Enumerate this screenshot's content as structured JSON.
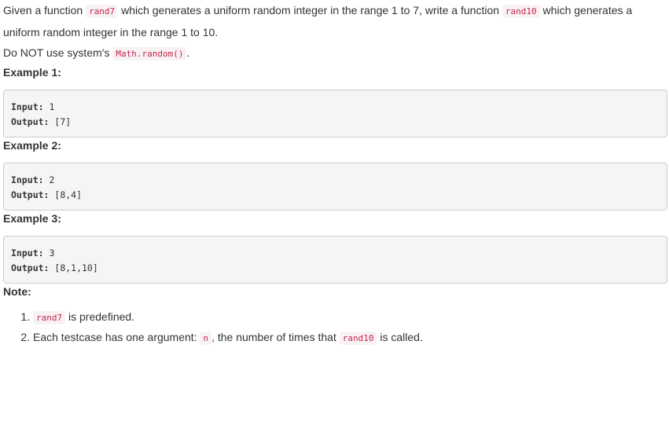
{
  "description": {
    "line1_pre": "Given a function ",
    "line1_code1": "rand7",
    "line1_mid": " which generates a uniform random integer in the range 1 to 7, write a function ",
    "line1_code2": "rand10",
    "line1_post": " which generates a uniform random integer in the range 1 to 10.",
    "line2_pre": "Do NOT use system's ",
    "line2_code": "Math.random()",
    "line2_post": "."
  },
  "examples": [
    {
      "heading": "Example 1:",
      "input_label": "Input:",
      "input_value": " 1",
      "output_label": "Output:",
      "output_value": " [7]"
    },
    {
      "heading": "Example 2:",
      "input_label": "Input:",
      "input_value": " 2",
      "output_label": "Output:",
      "output_value": " [8,4]"
    },
    {
      "heading": "Example 3:",
      "input_label": "Input:",
      "input_value": " 3",
      "output_label": "Output:",
      "output_value": " [8,1,10]"
    }
  ],
  "note": {
    "heading": "Note:",
    "item1_code": "rand7",
    "item1_text": " is predefined.",
    "item2_pre": "Each testcase has one argument: ",
    "item2_code1": "n",
    "item2_mid": ", the number of times that ",
    "item2_code2": "rand10",
    "item2_post": " is called."
  },
  "colors": {
    "inline_code_text": "#c7254e",
    "inline_code_bg": "#f9f2f4",
    "pre_bg": "#f5f5f5",
    "pre_border": "#cccccc",
    "body_text": "#333333"
  }
}
